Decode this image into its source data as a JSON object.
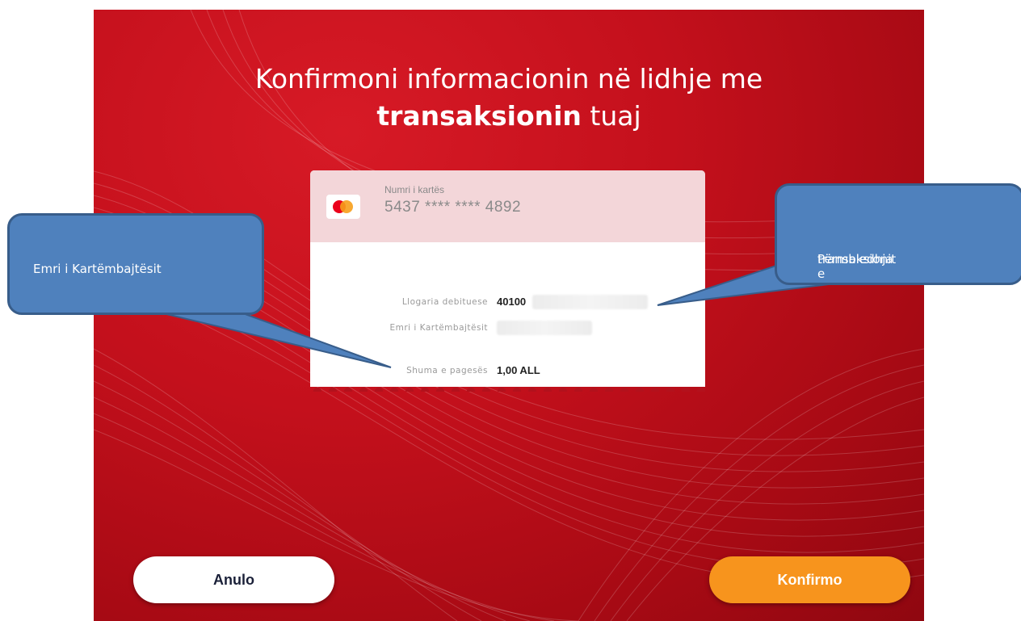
{
  "screen": {
    "title_line1": "Konfirmoni informacionin në lidhje me",
    "title_line2_bold": "transaksionin",
    "title_line2_rest": " tuaj",
    "background_color": "#c4101c"
  },
  "card": {
    "icon": "mastercard-logo",
    "label": "Numri i kartës",
    "number": "5437 **** **** 4892"
  },
  "rows": [
    {
      "label": "Llogaria debituese",
      "value": "40100"
    },
    {
      "label": "Emri i Kartëmbajtësit",
      "value": ""
    },
    {
      "label": "Shuma e pagesës",
      "value": "1,00 ALL"
    }
  ],
  "buttons": {
    "cancel_label": "Anulo",
    "confirm_label": "Konfirmo",
    "confirm_color": "#f7941d"
  },
  "callouts": {
    "left_text": "Emri i Kartëmbajtësit",
    "right_text_line1": "Përmbledhja e",
    "right_text_line2": "transaksionit",
    "color": "#4f81bd"
  }
}
